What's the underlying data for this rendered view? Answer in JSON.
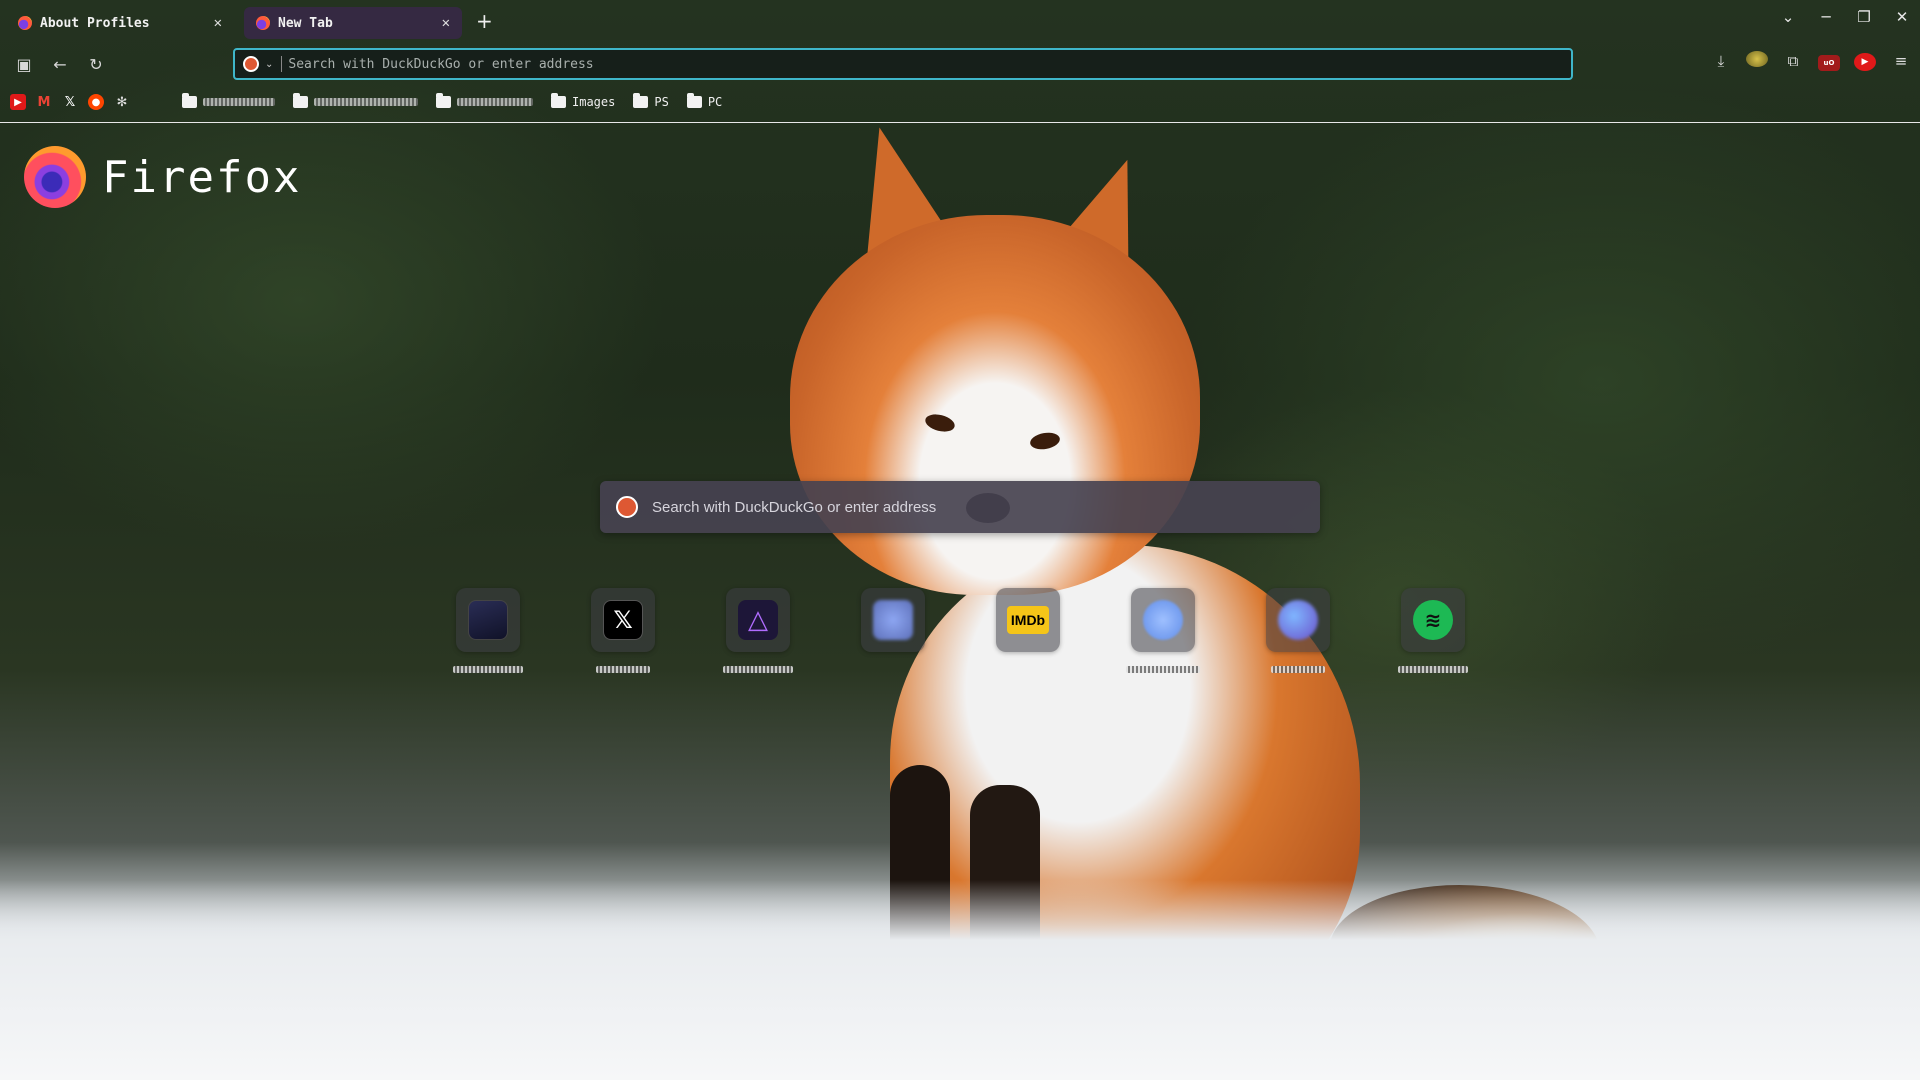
{
  "tabs": [
    {
      "label": "About Profiles",
      "close": "✕"
    },
    {
      "label": "New Tab",
      "close": "✕"
    }
  ],
  "new_tab_button": "+",
  "window_controls": {
    "list_all_tabs": "⌄",
    "minimize": "─",
    "restore": "❐",
    "close": "✕"
  },
  "navbar": {
    "sidebar": "▣",
    "back": "←",
    "reload": "↻",
    "url_placeholder": "Search with DuckDuckGo or enter address",
    "engine_chevron": "⌄"
  },
  "toolbar_right": {
    "downloads": "⤓",
    "extensions": "⧉",
    "ublock": "uO",
    "youtube": "▶",
    "menu": "≡"
  },
  "bookmarks": {
    "icons": [
      {
        "name": "youtube-bookmark-icon",
        "glyph": "▶"
      },
      {
        "name": "gmail-bookmark-icon",
        "glyph": "M"
      },
      {
        "name": "x-bookmark-icon",
        "glyph": "𝕏"
      },
      {
        "name": "reddit-bookmark-icon",
        "glyph": "●"
      },
      {
        "name": "chatgpt-bookmark-icon",
        "glyph": "✻"
      }
    ],
    "folders": [
      "Images",
      "PS",
      "PC"
    ]
  },
  "brand": {
    "name": "Firefox"
  },
  "search": {
    "placeholder": "Search with DuckDuckGo or enter address"
  },
  "shortcuts": [
    {
      "icon": "dark-app-icon",
      "glyph": ""
    },
    {
      "icon": "x-icon",
      "glyph": "𝕏"
    },
    {
      "icon": "jellyfin-icon",
      "glyph": "△"
    },
    {
      "icon": "blurred-app-icon",
      "glyph": ""
    },
    {
      "icon": "imdb-icon",
      "glyph": "IMDb"
    },
    {
      "icon": "blurred-circle-icon",
      "glyph": ""
    },
    {
      "icon": "blurred-gradient-icon",
      "glyph": ""
    },
    {
      "icon": "spotify-icon",
      "glyph": "≋"
    }
  ]
}
